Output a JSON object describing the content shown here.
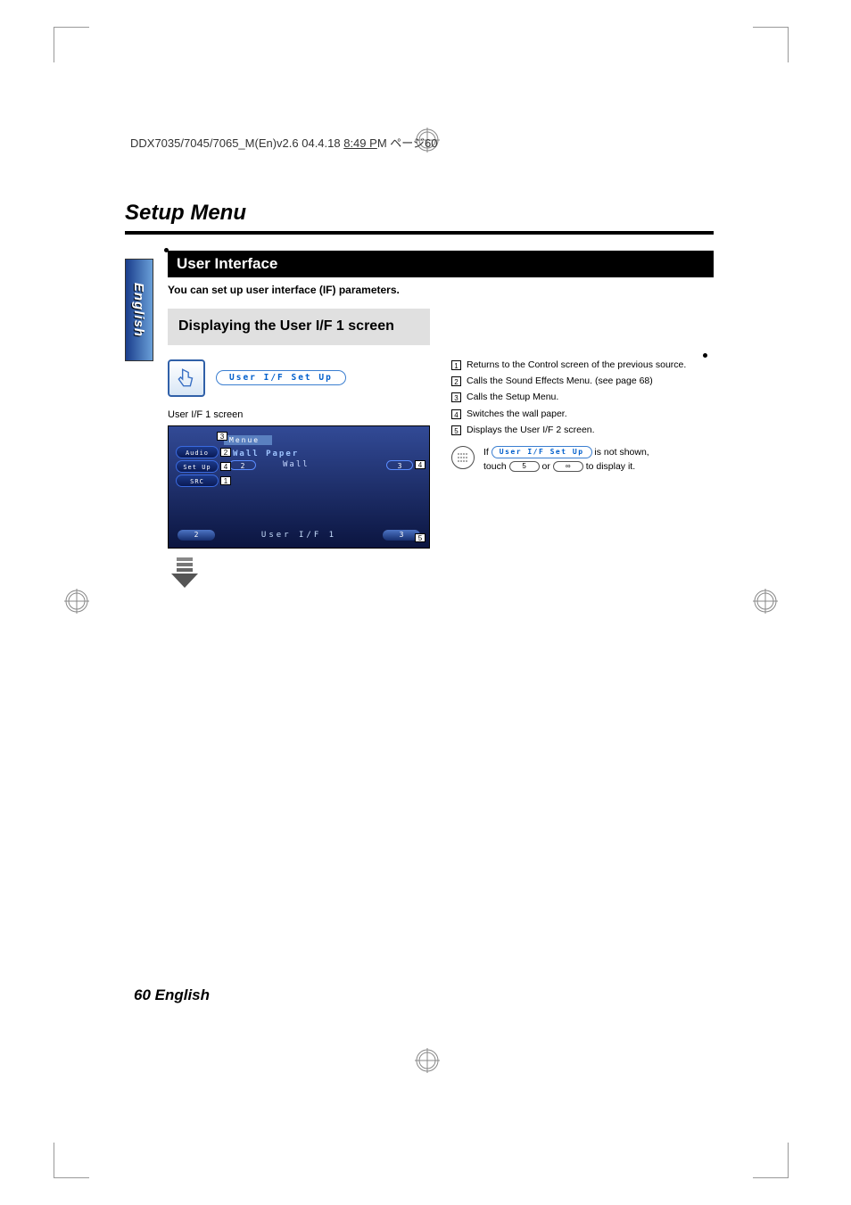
{
  "header_line": {
    "prefix": "DDX7035/7045/7065_M(En)v2.6  04.4.18  ",
    "underlined": "8:49 P",
    "suffix": "M  ページ60"
  },
  "title": "Setup Menu",
  "lang_tab": "English",
  "section": {
    "heading": "User Interface",
    "subheading": "You can set up user interface (IF) parameters."
  },
  "step_heading": "Displaying the User I/F 1 screen",
  "pill_main": "User  I/F  Set  Up",
  "screen_caption": "User I/F 1 screen",
  "screen": {
    "menue": "Menue",
    "audio": "Audio",
    "setup": "Set Up",
    "src": "SRC",
    "wallpaper_label": "Wall Paper",
    "wallpaper_value": "Wall",
    "bottom_title": "User  I/F  1"
  },
  "callouts": {
    "c1": "1",
    "c2": "2",
    "c3": "3",
    "c4_left": "4",
    "c4_right": "4",
    "c5": "5"
  },
  "definitions": [
    {
      "n": "1",
      "t": "Returns to the Control screen of the previous source."
    },
    {
      "n": "2",
      "t": "Calls the Sound Effects Menu. (see page 68)"
    },
    {
      "n": "3",
      "t": "Calls the Setup Menu."
    },
    {
      "n": "4",
      "t": "Switches the wall paper."
    },
    {
      "n": "5",
      "t": "Displays the User I/F 2 screen."
    }
  ],
  "note": {
    "if": "If",
    "pill": "User  I/F  Set  Up",
    "not_shown": " is not shown,",
    "touch": "touch ",
    "or": " or ",
    "end": " to display it."
  },
  "footer": "60 English"
}
